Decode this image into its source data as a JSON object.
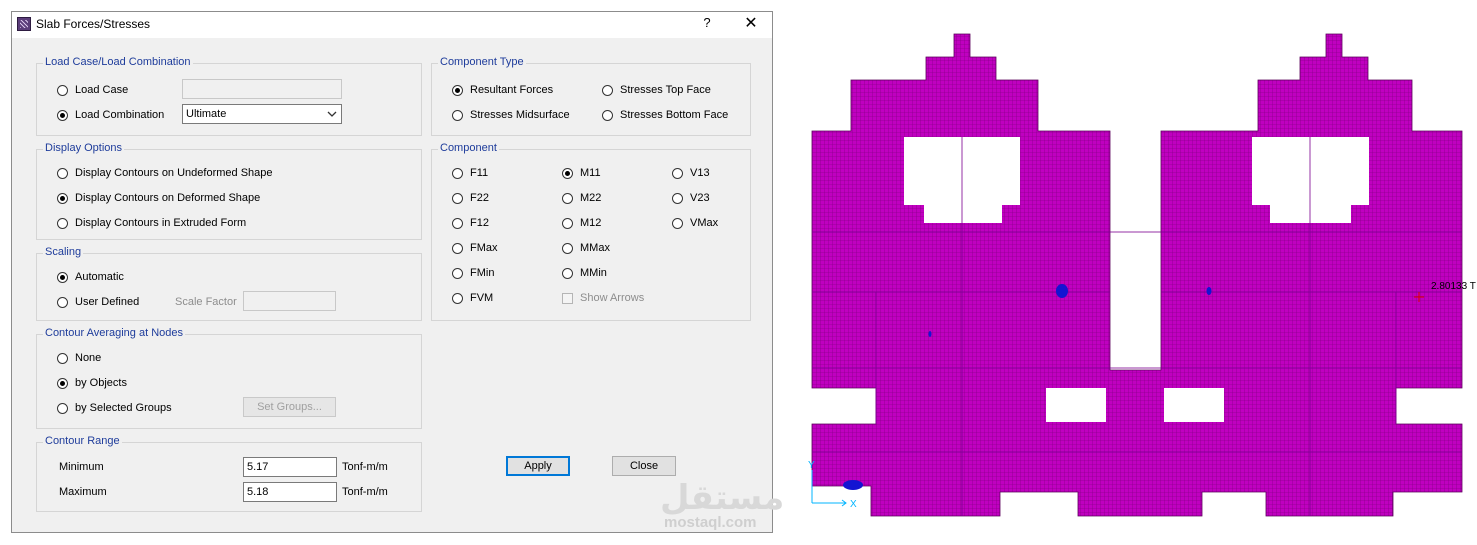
{
  "window": {
    "title": "Slab Forces/Stresses",
    "help": "?",
    "close": "✕"
  },
  "load_case": {
    "label": "Load Case/Load Combination",
    "load_case_label": "Load Case",
    "load_case_value": "",
    "load_combination_label": "Load Combination",
    "load_combination_value": "Ultimate",
    "selected": "load_combination"
  },
  "display_options": {
    "label": "Display Options",
    "items": [
      "Display Contours on Undeformed Shape",
      "Display Contours on Deformed Shape",
      "Display Contours in Extruded Form"
    ],
    "selected_index": 1
  },
  "scaling": {
    "label": "Scaling",
    "automatic": "Automatic",
    "user_defined": "User Defined",
    "scale_factor_label": "Scale Factor",
    "scale_factor_value": "",
    "selected": "automatic"
  },
  "averaging": {
    "label": "Contour Averaging at Nodes",
    "items": [
      "None",
      "by Objects",
      "by Selected Groups"
    ],
    "selected_index": 1,
    "set_groups_button": "Set Groups..."
  },
  "contour_range": {
    "label": "Contour Range",
    "minimum_label": "Minimum",
    "minimum_value": "5.17",
    "maximum_label": "Maximum",
    "maximum_value": "5.18",
    "unit": "Tonf-m/m"
  },
  "component_type": {
    "label": "Component Type",
    "resultant_forces": "Resultant Forces",
    "stresses_top": "Stresses Top Face",
    "stresses_mid": "Stresses Midsurface",
    "stresses_bottom": "Stresses Bottom Face",
    "selected": "resultant_forces"
  },
  "component": {
    "label": "Component",
    "col1": [
      "F11",
      "F22",
      "F12",
      "FMax",
      "FMin",
      "FVM"
    ],
    "col2": [
      "M11",
      "M22",
      "M12",
      "MMax",
      "MMin"
    ],
    "col3": [
      "V13",
      "V23",
      "VMax"
    ],
    "selected": "M11",
    "show_arrows": "Show Arrows"
  },
  "buttons": {
    "apply": "Apply",
    "close": "Close"
  },
  "canvas": {
    "value_label": "2.80133 T",
    "axis_x": "X",
    "axis_y": "Y",
    "slab_color": "#c000c0",
    "hotspot_color": "#1414d2"
  },
  "watermark": {
    "main": "مستقل",
    "sub": "mostaql.com"
  }
}
